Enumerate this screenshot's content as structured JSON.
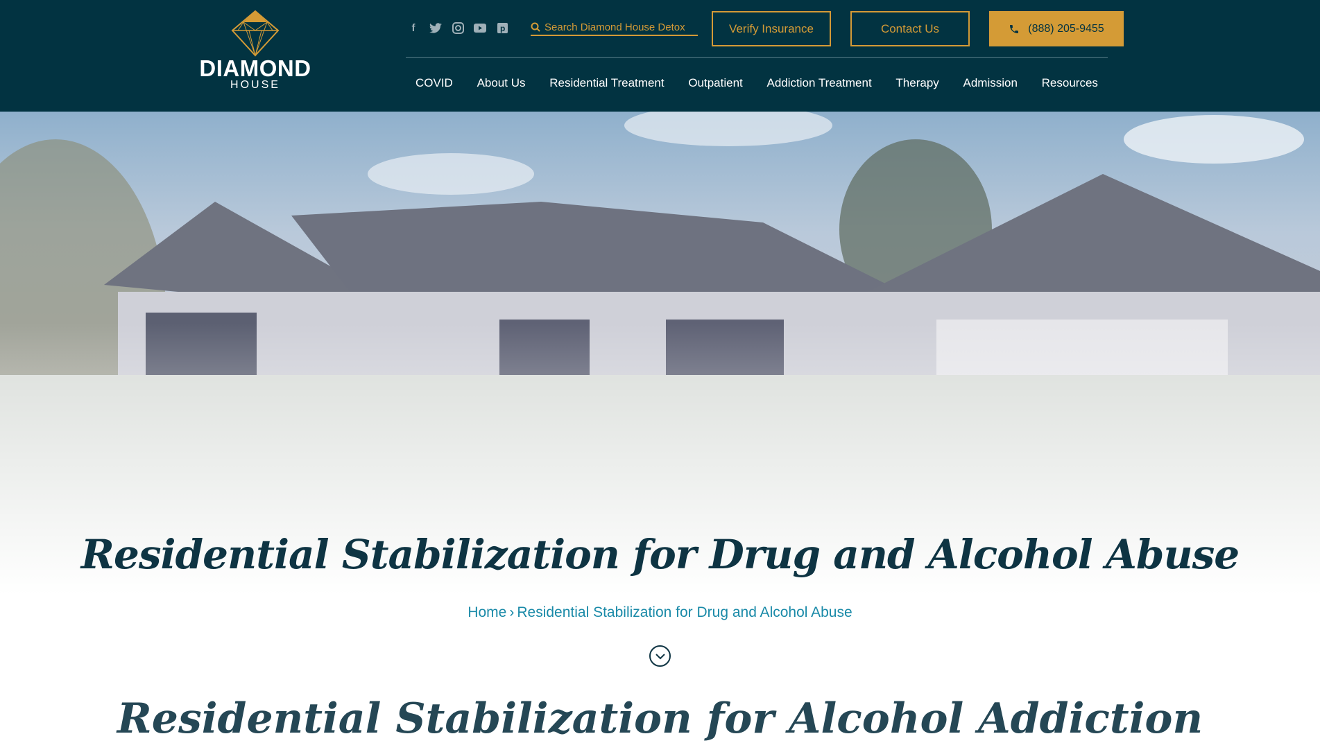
{
  "brand": {
    "name": "DIAMOND",
    "sub": "HOUSE",
    "color": "#d49b36",
    "header_bg": "#023341"
  },
  "social": [
    "facebook-icon",
    "twitter-icon",
    "instagram-icon",
    "youtube-icon",
    "pinterest-icon"
  ],
  "search": {
    "placeholder": "Search Diamond House Detox"
  },
  "buttons": {
    "verify": "Verify Insurance",
    "contact": "Contact Us",
    "phone": "(888) 205-9455"
  },
  "nav": [
    "COVID",
    "About Us",
    "Residential Treatment",
    "Outpatient",
    "Addiction Treatment",
    "Therapy",
    "Admission",
    "Resources"
  ],
  "hero": {
    "title": "Residential Stabilization for Drug and Alcohol Abuse",
    "breadcrumb": {
      "home": "Home",
      "sep": "›",
      "current": "Residential Stabilization for Drug and Alcohol Abuse"
    }
  },
  "section": {
    "title": "Residential Stabilization for Alcohol Addiction"
  }
}
